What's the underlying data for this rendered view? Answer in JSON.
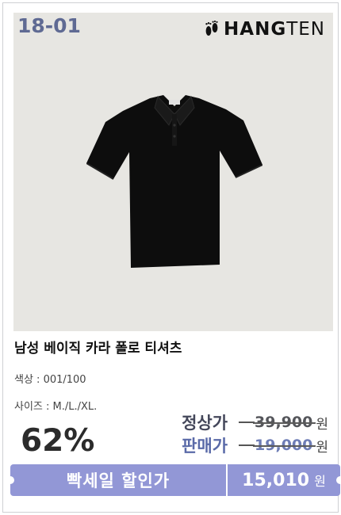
{
  "product": {
    "code": "18-01",
    "brand": "HANGTEN",
    "brand_part1": "HANG",
    "brand_part2": "TEN",
    "title": "남성 베이직 카라 폴로 티셔츠",
    "color_option": "색상 : 001/100",
    "size_option": "사이즈 : M./L./XL.",
    "image_icon": "black-polo-shirt"
  },
  "pricing": {
    "discount": "62%",
    "regular_label": "정상가",
    "regular_price": "39,900",
    "sale_label": "판매가",
    "sale_price": "19,000",
    "currency": "원"
  },
  "promo": {
    "flash_label": "빡세일 할인가",
    "final_price": "15,010",
    "currency": "원"
  },
  "colors": {
    "accent": "#9297d6",
    "code_color": "#5f6a93",
    "photo_bg": "#e7e6e2"
  }
}
